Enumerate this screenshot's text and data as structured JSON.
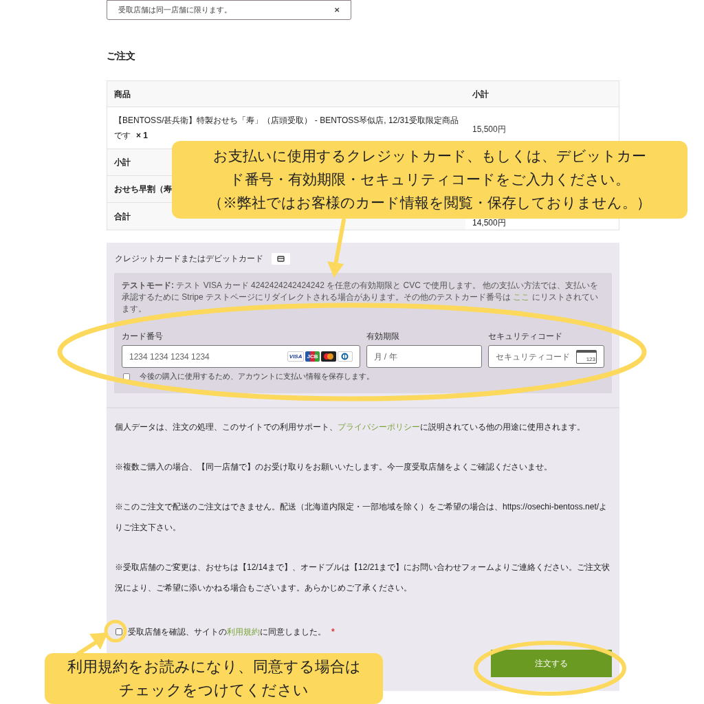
{
  "store_select": {
    "value": "受取店舗は同一店舗に限ります。",
    "icon": "✕"
  },
  "order_heading": "ご注文",
  "table": {
    "columns": [
      "商品",
      "小計"
    ],
    "rows": [
      {
        "kind": "item",
        "cells": [
          "【BENTOSS/甚兵衛】特製おせち「寿」（店頭受取） - BENTOSS琴似店, 12/31受取限定商品です",
          "15,500円"
        ],
        "qty": "× 1"
      },
      {
        "kind": "summary",
        "cells": [
          "小計"
        ]
      },
      {
        "kind": "summary",
        "cells": [
          "おせち早割（寿"
        ]
      },
      {
        "kind": "summary",
        "cells": [
          "合計",
          "14,500円"
        ]
      }
    ]
  },
  "payment": {
    "method_label": "クレジットカードまたはデビットカード",
    "notice": [
      {
        "text": "テストモード:",
        "kind": "bold"
      },
      {
        "text": " テスト VISA カード 4242424242424242 を任意の有効期限と CVC で使用します。 他の支払い方法では、支払いを承認するために Stripe テストページにリダイレクトされる場合があります。その他のテストカード番号は ",
        "kind": "plain"
      },
      {
        "text": "ここ",
        "kind": "link"
      },
      {
        "text": " にリストされています。",
        "kind": "plain"
      }
    ],
    "fields": [
      {
        "kind": "card",
        "label": "カード番号",
        "placeholder": "1234 1234 1234 1234",
        "brands": [
          "VISA",
          "JCB"
        ]
      },
      {
        "kind": "expiry",
        "label": "有効期限",
        "placeholder": "月 / 年"
      },
      {
        "kind": "cvc",
        "label": "セキュリティコード",
        "placeholder": "セキュリティコード",
        "badge": "123"
      }
    ],
    "save": {
      "label": "今後の購入に使用するため、アカウントに支払い情報を保存します。",
      "checked": false
    }
  },
  "notes": [
    [
      {
        "text": "個人データは、注文の処理、このサイトでの利用サポート、",
        "kind": "plain"
      },
      {
        "text": "プライバシーポリシー",
        "kind": "link"
      },
      {
        "text": "に説明されている他の用途に使用されます。",
        "kind": "plain"
      }
    ],
    [
      {
        "text": "※複数ご購入の場合、【同一店舗で】のお受け取りをお願いいたします。今一度受取店舗をよくご確認くださいませ。",
        "kind": "plain"
      }
    ],
    [
      {
        "text": "※このご注文で配送のご注文はできません。配送（北海道内限定・一部地域を除く）をご希望の場合は、https://osechi-bentoss.net/よりご注文下さい。",
        "kind": "plain"
      }
    ],
    [
      {
        "text": "※受取店舗のご変更は、おせちは【12/14まで】、オードブルは【12/21まで】にお問い合わせフォームよりご連絡ください。ご注文状況により、ご希望に添いかねる場合もございます。あらかじめご了承ください。",
        "kind": "plain"
      }
    ]
  ],
  "terms": {
    "checked": false,
    "parts": [
      {
        "text": "受取店舗を確認、サイトの",
        "kind": "plain"
      },
      {
        "text": "利用規約",
        "kind": "link"
      },
      {
        "text": "に同意しました。",
        "kind": "plain"
      }
    ],
    "required": "*"
  },
  "order_button": "注文する",
  "callouts": [
    {
      "lines": [
        "お支払いに使用するクレジットカード、もしくは、デビットカー",
        "ド番号・有効期限・セキュリティコードをご入力ください。",
        "（※弊社ではお客様のカード情報を閲覧・保存しておりません。）"
      ]
    },
    {
      "lines": [
        "利用規約をお読みになり、同意する場合は",
        "チェックをつけてください"
      ]
    }
  ]
}
